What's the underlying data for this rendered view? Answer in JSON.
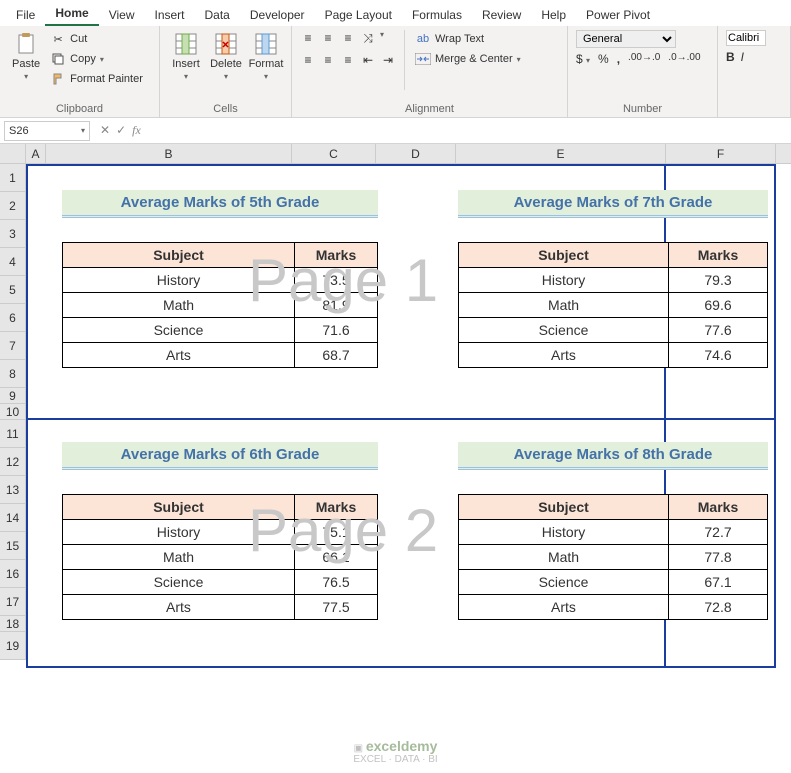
{
  "tabs": {
    "file": "File",
    "home": "Home",
    "view": "View",
    "insert": "Insert",
    "data": "Data",
    "developer": "Developer",
    "page_layout": "Page Layout",
    "formulas": "Formulas",
    "review": "Review",
    "help": "Help",
    "power_pivot": "Power Pivot"
  },
  "ribbon": {
    "clipboard": {
      "label": "Clipboard",
      "paste": "Paste",
      "cut": "Cut",
      "copy": "Copy",
      "format_painter": "Format Painter"
    },
    "cells": {
      "label": "Cells",
      "insert": "Insert",
      "delete": "Delete",
      "format": "Format"
    },
    "alignment": {
      "label": "Alignment",
      "wrap_text": "Wrap Text",
      "merge_center": "Merge & Center"
    },
    "number": {
      "label": "Number",
      "format": "General"
    },
    "font": {
      "name": "Calibri"
    }
  },
  "formula_bar": {
    "cell_ref": "S26",
    "fx": "fx",
    "value": ""
  },
  "columns": {
    "A": "A",
    "B": "B",
    "C": "C",
    "D": "D",
    "E": "E",
    "F": "F"
  },
  "rows": [
    "1",
    "2",
    "3",
    "4",
    "5",
    "6",
    "7",
    "8",
    "9",
    "10",
    "11",
    "12",
    "13",
    "14",
    "15",
    "16",
    "17",
    "18",
    "19"
  ],
  "watermarks": {
    "p1": "Page 1",
    "p2": "Page 2"
  },
  "tables": {
    "g5": {
      "title": "Average Marks of 5th Grade",
      "h1": "Subject",
      "h2": "Marks",
      "rows": [
        {
          "s": "History",
          "m": "73.5"
        },
        {
          "s": "Math",
          "m": "81.9"
        },
        {
          "s": "Science",
          "m": "71.6"
        },
        {
          "s": "Arts",
          "m": "68.7"
        }
      ]
    },
    "g7": {
      "title": "Average Marks of 7th Grade",
      "h1": "Subject",
      "h2": "Marks",
      "rows": [
        {
          "s": "History",
          "m": "79.3"
        },
        {
          "s": "Math",
          "m": "69.6"
        },
        {
          "s": "Science",
          "m": "77.6"
        },
        {
          "s": "Arts",
          "m": "74.6"
        }
      ]
    },
    "g6": {
      "title": "Average Marks of 6th Grade",
      "h1": "Subject",
      "h2": "Marks",
      "rows": [
        {
          "s": "History",
          "m": "75.1"
        },
        {
          "s": "Math",
          "m": "66.1"
        },
        {
          "s": "Science",
          "m": "76.5"
        },
        {
          "s": "Arts",
          "m": "77.5"
        }
      ]
    },
    "g8": {
      "title": "Average Marks of 8th Grade",
      "h1": "Subject",
      "h2": "Marks",
      "rows": [
        {
          "s": "History",
          "m": "72.7"
        },
        {
          "s": "Math",
          "m": "77.8"
        },
        {
          "s": "Science",
          "m": "67.1"
        },
        {
          "s": "Arts",
          "m": "72.8"
        }
      ]
    }
  },
  "logo": {
    "name": "exceldemy",
    "tag": "EXCEL · DATA · BI"
  }
}
